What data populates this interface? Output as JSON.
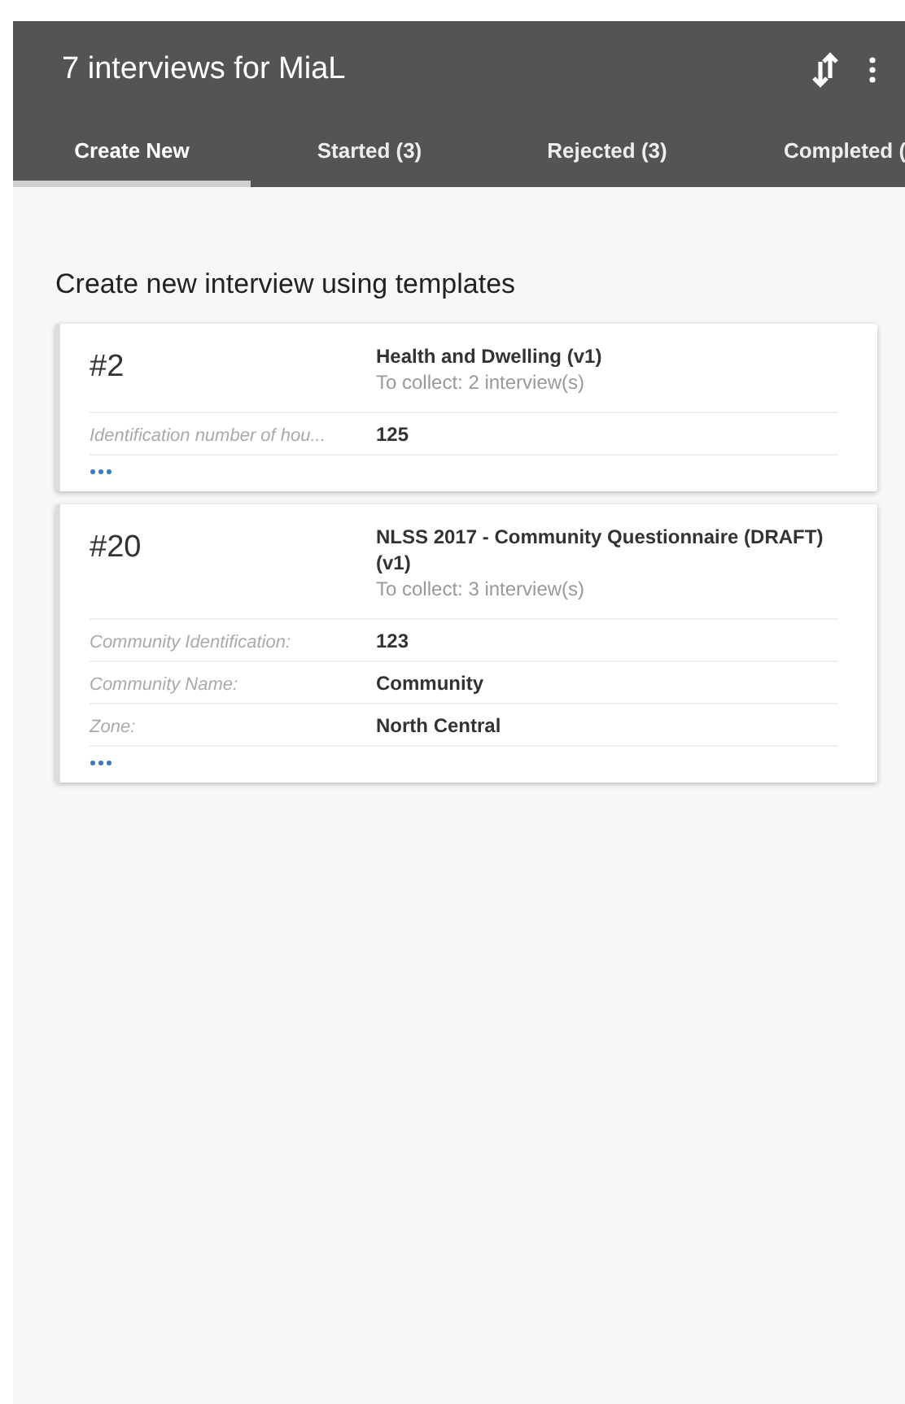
{
  "toolbar": {
    "title": "7 interviews for MiaL"
  },
  "tabs": [
    {
      "label": "Create New",
      "selected": true
    },
    {
      "label": "Started (3)",
      "selected": false
    },
    {
      "label": "Rejected (3)",
      "selected": false
    },
    {
      "label": "Completed (",
      "selected": false
    }
  ],
  "section_title": "Create new interview using templates",
  "cards": [
    {
      "number": "#2",
      "title": "Health and Dwelling (v1)",
      "subtitle": "To collect: 2 interview(s)",
      "fields": [
        {
          "label": "Identification number of hou...",
          "value": "125"
        }
      ]
    },
    {
      "number": "#20",
      "title": "NLSS 2017 - Community Questionnaire (DRAFT) (v1)",
      "subtitle": "To collect: 3 interview(s)",
      "fields": [
        {
          "label": "Community Identification:",
          "value": "123"
        },
        {
          "label": "Community Name:",
          "value": "Community"
        },
        {
          "label": "Zone:",
          "value": "North Central"
        }
      ]
    }
  ]
}
